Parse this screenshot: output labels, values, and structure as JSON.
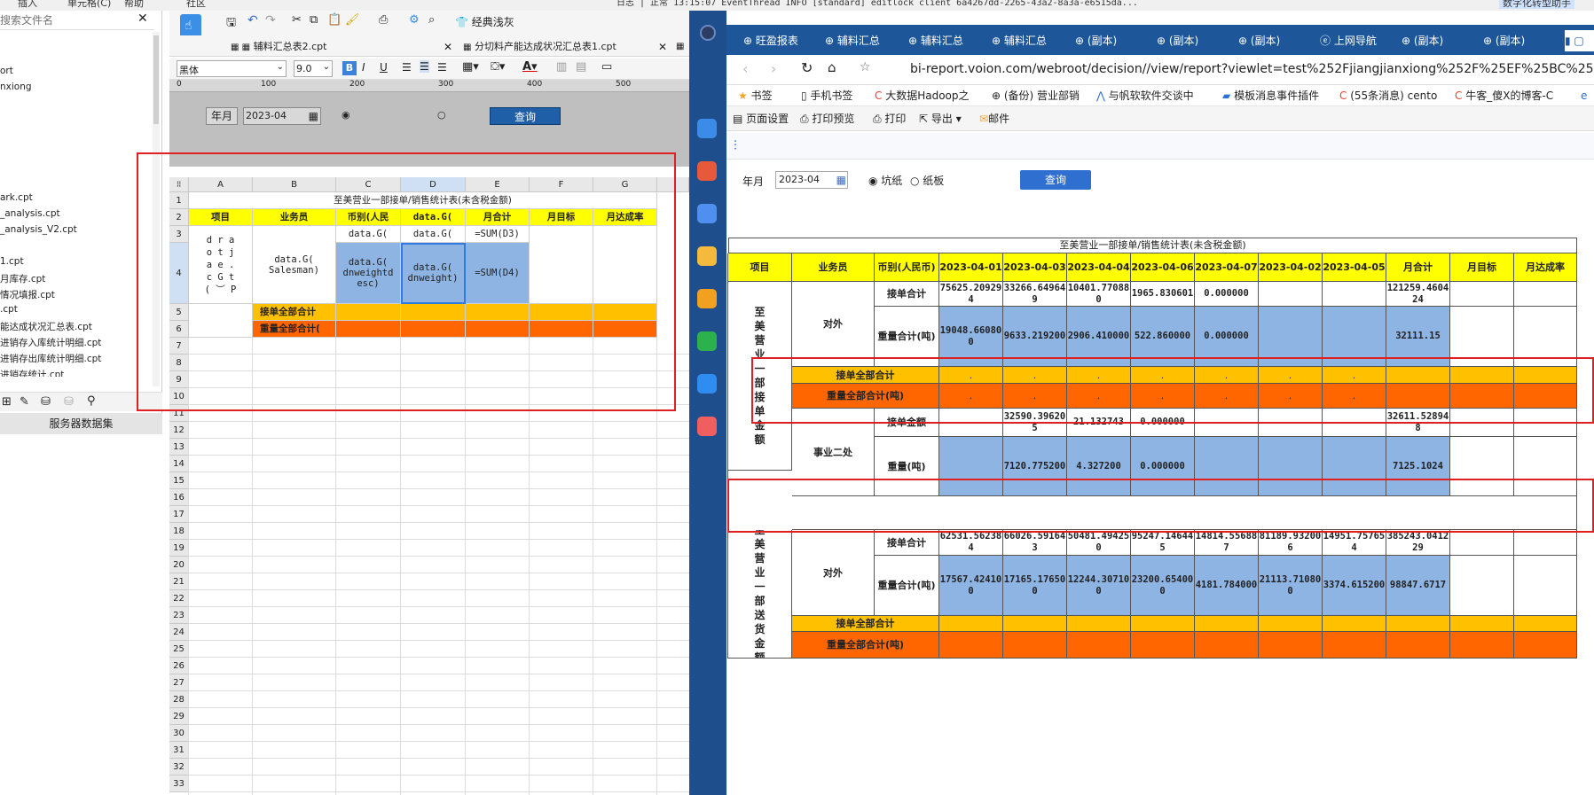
{
  "top_menu": {
    "items": [
      "插入",
      "单元格(C)",
      "帮助",
      "社区"
    ],
    "log_text": "日志 | 正常 13:15:07 EventThread INFO [standard] editlock client 6a4267dd-2265-43a2-8a3a-e6515da...",
    "brand": "数字化转型助手"
  },
  "left_panel": {
    "search_placeholder": "搜索文件名",
    "files": [
      "ort",
      "nxiong",
      "ark.cpt",
      "_analysis.cpt",
      "_analysis_V2.cpt",
      "1.cpt",
      "月库存.cpt",
      "情况填报.cpt",
      ".cpt",
      "能达成状况汇总表.cpt",
      "进销存入库统计明细.cpt",
      "进销存出库统计明细.cpt",
      "进销存统计.cpt"
    ],
    "dataset_tab": "服务器数据集"
  },
  "designer": {
    "toolbar_label": "经典浅灰",
    "tabs": [
      "辅料汇总表2.cpt",
      "分切料产能达成状况汇总表1.cpt"
    ],
    "font": "黑体",
    "font_size": "9.0",
    "ruler": [
      "100",
      "200",
      "300",
      "400",
      "500"
    ],
    "param_label": "年月",
    "param_value": "2023-04",
    "query_label": "查询",
    "col_headers": [
      "A",
      "B",
      "C",
      "D",
      "E",
      "F",
      "G"
    ],
    "row_numbers": [
      "1",
      "2",
      "3",
      "4",
      "5",
      "6",
      "7",
      "8",
      "9",
      "10",
      "11",
      "12",
      "13",
      "14",
      "15",
      "16",
      "17",
      "18",
      "19",
      "20",
      "21",
      "22",
      "23",
      "24",
      "25",
      "26",
      "27",
      "28",
      "29",
      "30",
      "31",
      "32",
      "33"
    ],
    "title": "至美营业一部接单/销售统计表(未含税金额)",
    "headers": [
      "项目",
      "业务员",
      "币别(人民",
      "data.G(",
      "月合计",
      "月目标",
      "月达成率"
    ],
    "r3": [
      "data.G(",
      "data.G(",
      "=SUM(D3)"
    ],
    "a_cell": "d r a o t j a e . c G t ( ︶ P",
    "salesman": "data.G( Salesman)",
    "r4": [
      "data.G( dnweightd esc)",
      "data.G( dnweight)",
      "=SUM(D4)"
    ],
    "r5": "接单全部合计",
    "r6": "重量全部合计("
  },
  "browser": {
    "tabs": [
      "旺盈报表",
      "辅料汇总",
      "辅料汇总",
      "辅料汇总",
      "(副本)",
      "(副本)",
      "(副本)",
      "上网导航",
      "(副本)",
      "(副本)"
    ],
    "url": "bi-report.voion.com/webroot/decision//view/report?viewlet=test%252Fjiangjianxiong%252F%25EF%25BC%2588%2",
    "bookmarks": [
      "书签",
      "手机书签",
      "大数据Hadoop之",
      "(备份) 营业部销",
      "与帆软软件交谈中",
      "模板消息事件插件",
      "(55条消息) cento",
      "牛客_傻X的博客-C"
    ],
    "tools": [
      "页面设置",
      "打印预览",
      "打印",
      "导出",
      "邮件"
    ],
    "param_label": "年月",
    "param_value": "2023-04",
    "radio1": "坑纸",
    "radio2": "纸板",
    "query_label": "查询"
  },
  "report": {
    "title": "至美营业一部接单/销售统计表(未含税金额)",
    "headers": [
      "项目",
      "业务员",
      "币别(人民币)",
      "2023-04-01",
      "2023-04-03",
      "2023-04-04",
      "2023-04-06",
      "2023-04-07",
      "2023-04-02",
      "2023-04-05",
      "月合计",
      "月目标",
      "月达成率"
    ],
    "section1": "至美营业一部接单金额",
    "section2": "至美营业一部送货金额",
    "dept_a": "对外",
    "dept_b": "事业二处",
    "row_jd": "接单合计",
    "row_zl": "重量合计(吨)",
    "row_jd_all": "接单全部合计",
    "row_zl_all": "重量全部合计(吨)",
    "row_jd_b": "接单金额",
    "row_zl_b": "重量(吨)",
    "s1_a_jd": [
      "75625.209294",
      "33266.649649",
      "10401.770880",
      "1965.830601",
      "0.000000",
      "",
      "",
      "121259.460424"
    ],
    "s1_a_zl": [
      "19048.660800",
      "9633.219200",
      "2906.410000",
      "522.860000",
      "0.000000",
      "",
      "",
      "32111.15"
    ],
    "dots": [
      ".",
      ".",
      ".",
      ".",
      ".",
      ".",
      "."
    ],
    "s1_b_jd": [
      "",
      "32590.396205",
      "21.132743",
      "0.000000",
      "",
      "",
      "",
      "32611.528948"
    ],
    "s1_b_zl": [
      "",
      "7120.775200",
      "4.327200",
      "0.000000",
      "",
      "",
      "",
      "7125.1024"
    ],
    "s2_a_jd": [
      "62531.562384",
      "66026.591643",
      "50481.494250",
      "95247.146445",
      "14814.556887",
      "81189.932006",
      "14951.757654",
      "385243.041229"
    ],
    "s2_a_zl": [
      "17567.424100",
      "17165.176500",
      "12244.307100",
      "23200.654000",
      "4181.784000",
      "21113.710800",
      "3374.615200",
      "98847.6717"
    ]
  }
}
